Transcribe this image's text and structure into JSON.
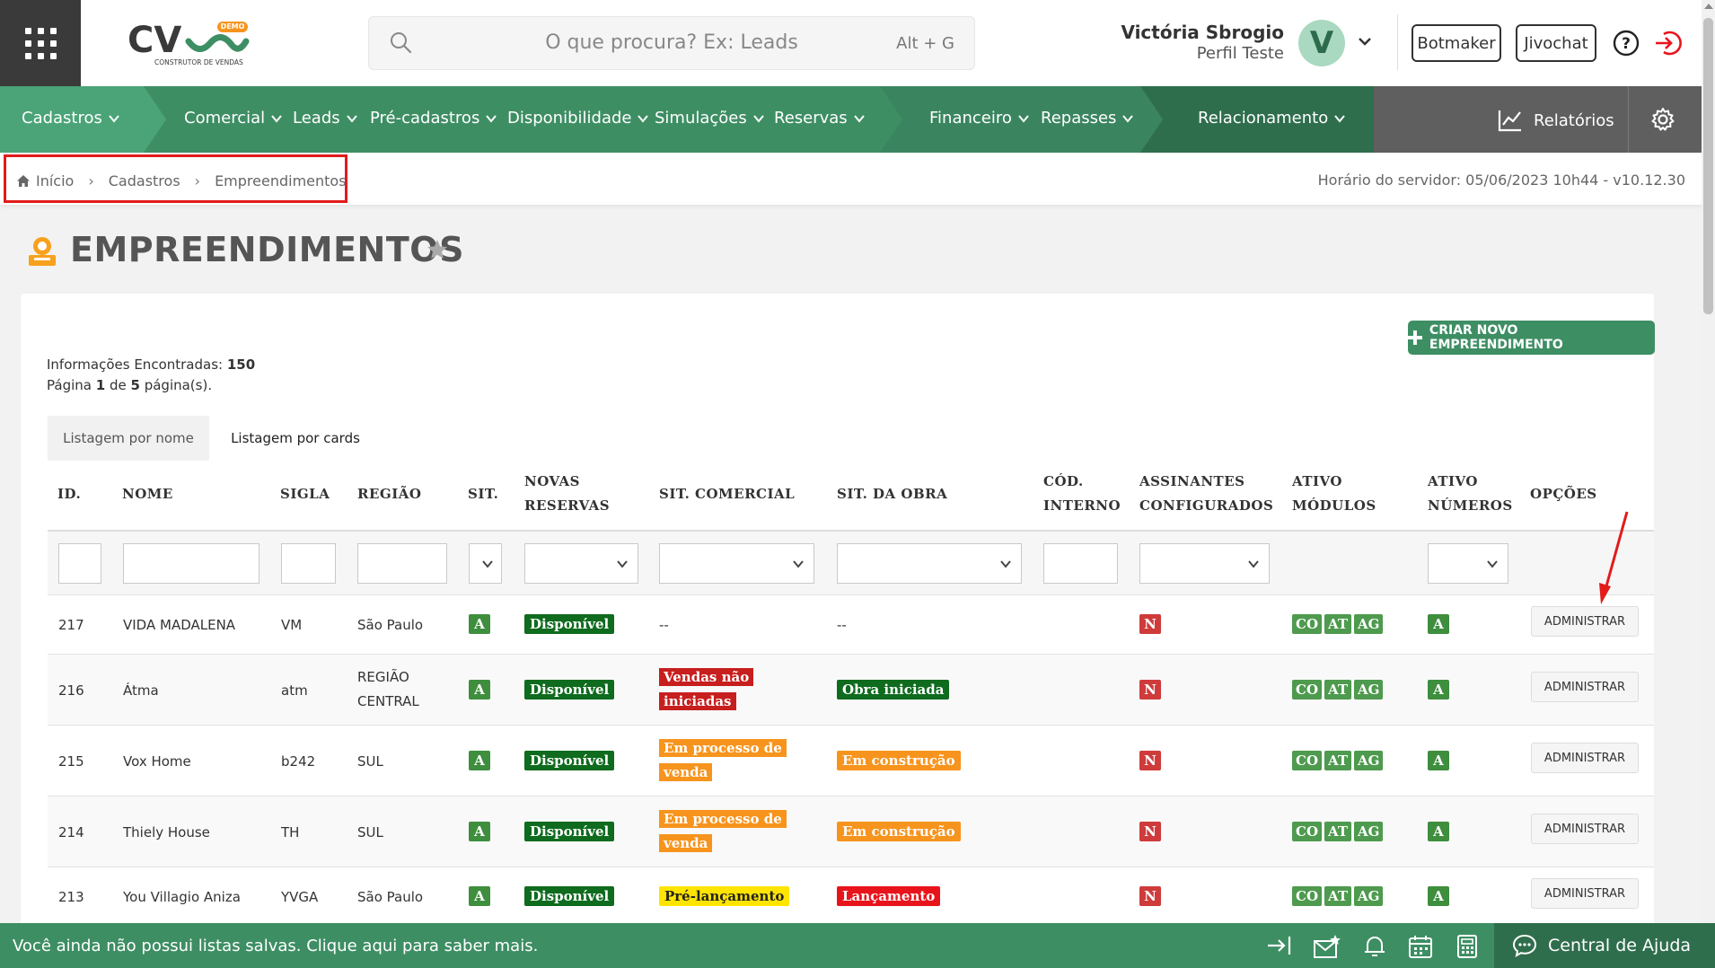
{
  "header": {
    "search_placeholder": "O que procura? Ex: Leads",
    "search_shortcut": "Alt + G",
    "user_name": "Victória Sbrogio",
    "user_role": "Perfil Teste",
    "avatar_letter": "V",
    "botmaker": "Botmaker",
    "jivochat": "Jivochat",
    "logo_badge": "DEMO",
    "logo_tagline": "CONSTRUTOR DE VENDAS"
  },
  "nav": {
    "cadastros": "Cadastros",
    "comercial": "Comercial",
    "leads": "Leads",
    "pre_cadastros": "Pré-cadastros",
    "disponibilidade": "Disponibilidade",
    "simulacoes": "Simulações",
    "reservas": "Reservas",
    "financeiro": "Financeiro",
    "repasses": "Repasses",
    "relacionamento": "Relacionamento",
    "relatorios": "Relatórios"
  },
  "breadcrumb": {
    "home": "Início",
    "level1": "Cadastros",
    "level2": "Empreendimentos"
  },
  "server_time": "Horário do servidor: 05/06/2023 10h44 - v10.12.30",
  "page": {
    "title": "EMPREENDIMENTOS",
    "create_button": "CRIAR NOVO EMPREENDIMENTO",
    "info_label": "Informações Encontradas:",
    "info_count": "150",
    "page_word": "Página",
    "page_current": "1",
    "page_of": "de",
    "page_total": "5",
    "page_suffix": "página(s).",
    "tab_by_name": "Listagem por nome",
    "tab_by_cards": "Listagem por cards"
  },
  "table": {
    "headers": {
      "id": "ID.",
      "nome": "NOME",
      "sigla": "SIGLA",
      "regiao": "REGIÃO",
      "sit": "SIT.",
      "novas_reservas_1": "NOVAS",
      "novas_reservas_2": "RESERVAS",
      "sit_comercial": "SIT. COMERCIAL",
      "sit_obra": "SIT. DA OBRA",
      "cod_interno_1": "CÓD.",
      "cod_interno_2": "INTERNO",
      "assinantes_1": "ASSINANTES",
      "assinantes_2": "CONFIGURADOS",
      "ativo_modulos_1": "ATIVO",
      "ativo_modulos_2": "MÓDULOS",
      "ativo_numeros_1": "ATIVO",
      "ativo_numeros_2": "NÚMEROS",
      "opcoes": "OPÇÕES"
    },
    "rows": [
      {
        "id": "217",
        "nome": "VIDA MADALENA",
        "sigla": "VM",
        "regiao": "São Paulo",
        "sit": "A",
        "novas_reservas": "Disponível",
        "sit_comercial": "--",
        "sit_obra": "--",
        "assinantes": "N",
        "mod_co": "CO",
        "mod_at": "AT",
        "mod_ag": "AG",
        "ativo_numeros": "A",
        "acao": "ADMINISTRAR"
      },
      {
        "id": "216",
        "nome": "Átma",
        "sigla": "atm",
        "regiao": "REGIÃO CENTRAL",
        "sit": "A",
        "novas_reservas": "Disponível",
        "sit_comercial": "Vendas não iniciadas",
        "sit_obra": "Obra iniciada",
        "assinantes": "N",
        "mod_co": "CO",
        "mod_at": "AT",
        "mod_ag": "AG",
        "ativo_numeros": "A",
        "acao": "ADMINISTRAR"
      },
      {
        "id": "215",
        "nome": "Vox Home",
        "sigla": "b242",
        "regiao": "SUL",
        "sit": "A",
        "novas_reservas": "Disponível",
        "sit_comercial": "Em processo de venda",
        "sit_obra": "Em construção",
        "assinantes": "N",
        "mod_co": "CO",
        "mod_at": "AT",
        "mod_ag": "AG",
        "ativo_numeros": "A",
        "acao": "ADMINISTRAR"
      },
      {
        "id": "214",
        "nome": "Thiely House",
        "sigla": "TH",
        "regiao": "SUL",
        "sit": "A",
        "novas_reservas": "Disponível",
        "sit_comercial": "Em processo de venda",
        "sit_obra": "Em construção",
        "assinantes": "N",
        "mod_co": "CO",
        "mod_at": "AT",
        "mod_ag": "AG",
        "ativo_numeros": "A",
        "acao": "ADMINISTRAR"
      },
      {
        "id": "213",
        "nome": "You Villagio Aniza",
        "sigla": "YVGA",
        "regiao": "São Paulo",
        "sit": "A",
        "novas_reservas": "Disponível",
        "sit_comercial": "Pré-lançamento",
        "sit_obra": "Lançamento",
        "assinantes": "N",
        "mod_co": "CO",
        "mod_at": "AT",
        "mod_ag": "AG",
        "ativo_numeros": "A",
        "acao": "ADMINISTRAR"
      }
    ]
  },
  "footer": {
    "message": "Você ainda não possui listas salvas. Clique aqui para saber mais.",
    "help": "Central de Ajuda"
  },
  "colors": {
    "primary_green": "#3e8e64",
    "annotation_red": "#e21b1b"
  }
}
